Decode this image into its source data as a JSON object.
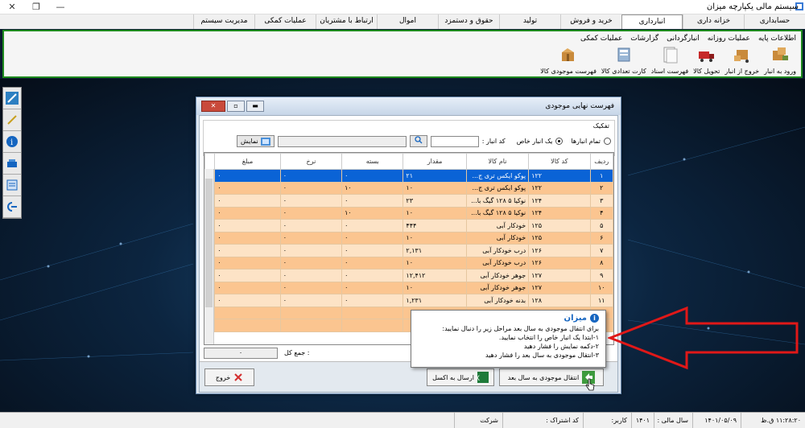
{
  "window": {
    "title": "سیستم مالی یکپارچه میزان"
  },
  "menu": {
    "items": [
      "حسابداری",
      "خزانه داری",
      "انبارداری",
      "خرید و فروش",
      "تولید",
      "حقوق و دستمزد",
      "اموال",
      "ارتباط با مشتریان",
      "عملیات کمکی",
      "مدیریت سیستم"
    ],
    "active": "انبارداری"
  },
  "ribbon": {
    "tabs": [
      "اطلاعات پایه",
      "عملیات روزانه",
      "انبارگردانی",
      "گزارشات",
      "عملیات کمکی"
    ],
    "tools": [
      {
        "label": "ورود به انبار",
        "icon": "warehouse-in-icon"
      },
      {
        "label": "خروج از انبار",
        "icon": "warehouse-out-icon"
      },
      {
        "label": "تحویل کالا",
        "icon": "truck-icon"
      },
      {
        "label": "فهرست اسناد",
        "icon": "documents-icon"
      },
      {
        "label": "کارت تعدادی کالا",
        "icon": "card-icon"
      },
      {
        "label": "فهرست موجودی کالا",
        "icon": "inventory-list-icon"
      }
    ]
  },
  "dialog": {
    "title": "فهرست نهایی موجودی",
    "filter": {
      "group_label": "تفکیک",
      "all_label": "تمام انبارها",
      "single_label": "یک انبار خاص",
      "code_label": "کد انبار :",
      "show_label": "نمایش"
    },
    "grid": {
      "columns": [
        "ردیف",
        "کد کالا",
        "نام کالا",
        "مقدار",
        "بسته",
        "نرخ",
        "مبلغ"
      ],
      "rows": [
        [
          "۱",
          "۱۲۲",
          "پوکو ایکس تری ج...",
          "۲۱",
          "۰",
          "۰",
          "۰"
        ],
        [
          "۲",
          "۱۲۲",
          "پوکو ایکس تری ج...",
          "۱۰",
          "۱۰",
          "۰",
          "۰"
        ],
        [
          "۳",
          "۱۲۴",
          "نوکیا ۵ ۱۲۸ گیگ با...",
          "۲۳",
          "۰",
          "۰",
          "۰"
        ],
        [
          "۴",
          "۱۲۴",
          "نوکیا ۵ ۱۲۸ گیگ با...",
          "۱۰",
          "۱۰",
          "۰",
          "۰"
        ],
        [
          "۵",
          "۱۲۵",
          "خودکار آبی",
          "۴۴۴",
          "۰",
          "۰",
          "۰"
        ],
        [
          "۶",
          "۱۲۵",
          "خودکار آبی",
          "۱۰",
          "۰",
          "۰",
          "۰"
        ],
        [
          "۷",
          "۱۲۶",
          "درب خودکار آبی",
          "۲,۱۳۱",
          "۰",
          "۰",
          "۰"
        ],
        [
          "۸",
          "۱۲۶",
          "درب خودکار آبی",
          "۱۰",
          "۰",
          "۰",
          "۰"
        ],
        [
          "۹",
          "۱۲۷",
          "جوهر خودکار آبی",
          "۱۲,۴۱۲",
          "۰",
          "۰",
          "۰"
        ],
        [
          "۱۰",
          "۱۲۷",
          "جوهر خودکار آبی",
          "۱۰",
          "۰",
          "۰",
          "۰"
        ],
        [
          "۱۱",
          "۱۲۸",
          "بدنه خودکار آبی",
          "۱,۲۳۱",
          "۰",
          "۰",
          "۰"
        ],
        [
          "",
          "",
          "",
          "",
          "",
          "",
          ""
        ],
        [
          "",
          "",
          "",
          "",
          "",
          "",
          ""
        ]
      ]
    },
    "total_label": "جمع کل :",
    "total_value": "۰",
    "buttons": {
      "transfer": "انتقال موجودی به سال بعد",
      "excel": "ارسال به اکسل",
      "exit": "خروج"
    }
  },
  "tooltip": {
    "title": "میزان",
    "lines": [
      "برای انتقال موجودی به سال بعد مراحل زیر را دنبال نمایید:",
      "۱-ابتدا یک انبار خاص را انتخاب نمایید.",
      "۲-دکمه نمایش را فشار دهید",
      "۳-انتقال موجودی به سال بعد را فشار دهید"
    ]
  },
  "status": {
    "time": "۱۱:۲۸:۲۰ ق.ظ",
    "date": "۱۴۰۱/۰۵/۰۹",
    "fiscal_label": "سال مالی :",
    "fiscal_value": "۱۴۰۱",
    "user_label": "کاربر:",
    "share_label": "کد اشتراک :",
    "company_label": "شرکت"
  },
  "colors": {
    "accent": "#1e8a1e",
    "selected": "#0a63d6",
    "row_odd": "#fbc590",
    "row_even": "#fde3c6",
    "arrow": "#e01818"
  }
}
